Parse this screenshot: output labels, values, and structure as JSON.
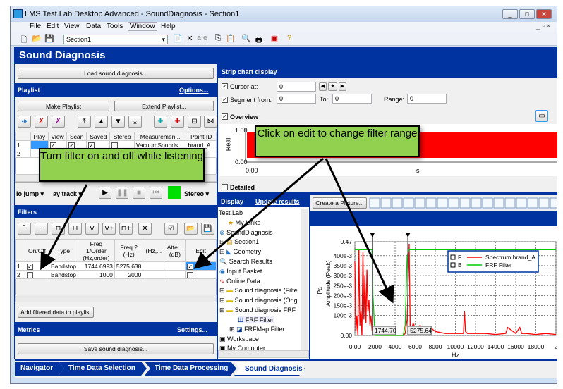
{
  "window": {
    "title": "LMS Test.Lab Desktop Advanced - SoundDiagnosis - Section1",
    "controls": [
      "_",
      "□",
      "✕"
    ]
  },
  "menu": [
    "File",
    "Edit",
    "View",
    "Data",
    "Tools",
    "Window",
    "Help"
  ],
  "toolbar": {
    "section": "Section1"
  },
  "page_title": "Sound Diagnosis",
  "left": {
    "load_button": "Load sound diagnosis...",
    "playlist": {
      "title": "Playlist",
      "options": "Options...",
      "make": "Make Playlist",
      "extend": "Extend Playlist...",
      "columns": [
        "",
        "Play",
        "View",
        "Scan",
        "Saved",
        "Stereo",
        "Measuremen...",
        "Point ID"
      ],
      "rows": [
        {
          "n": "1",
          "view": true,
          "scan": true,
          "saved": true,
          "stereo": false,
          "measurement": "VacuumSounds",
          "point": "brand_A"
        },
        {
          "n": "2"
        }
      ]
    },
    "playback": {
      "jump": "lo jump",
      "track": "ay track",
      "mode": "Stereo"
    },
    "filters": {
      "title": "Filters",
      "columns": [
        "",
        "On/Off",
        "Type",
        "Freq 1/Order (Hz,order)",
        "Freq 2 (Hz)",
        "(Hz,...",
        "Atte... (dB)",
        "Edit"
      ],
      "rows": [
        {
          "n": "1",
          "on": true,
          "type": "Bandstop",
          "f1": "1744.6993",
          "f2": "5275.638",
          "edit": true
        },
        {
          "n": "2",
          "on": false,
          "type": "Bandstop",
          "f1": "1000",
          "f2": "2000",
          "edit": false
        }
      ],
      "add_button": "Add filtered data to playlist"
    },
    "metrics": {
      "title": "Metrics",
      "settings": "Settings...",
      "save_button": "Save sound diagnosis..."
    }
  },
  "strip": {
    "title": "Strip chart display",
    "cursor_label": "Cursor at:",
    "cursor": "0",
    "segment_label": "Segment from:",
    "segment_from": "0",
    "to_label": "To:",
    "to": "0",
    "range_label": "Range:",
    "range": "0",
    "overview": "Overview",
    "detailed": "Detailed",
    "y_label": "Real",
    "y_ticks": [
      "1.00",
      "0.00"
    ],
    "x_ticks": [
      "0.00"
    ],
    "x_unit": "s"
  },
  "display": {
    "title": "Display",
    "update": "Update results",
    "tree": [
      "Test.Lab",
      "My Links",
      "SoundDiagnosis",
      "Section1",
      "Geometry",
      "Search Results",
      "Input Basket",
      "Online Data",
      "Sound diagnosis (Filte",
      "Sound diagnosis (Orig",
      "Sound diagnosis FRF",
      "FRF Filter",
      "FRFMap Filter",
      "Workspace",
      "My Computer"
    ]
  },
  "picture_button": "Create a Picture...",
  "chart_data": {
    "type": "line",
    "xlabel": "Hz",
    "ylabel": "Amplitude (Peak)",
    "yunit": "Pa",
    "xlim": [
      0,
      20000
    ],
    "ylim": [
      0,
      0.47
    ],
    "x_ticks": [
      "0.00",
      "2000",
      "4000",
      "6000",
      "8000",
      "10000",
      "12000",
      "14000",
      "16000",
      "18000",
      "2"
    ],
    "y_ticks": [
      "0.47",
      "400e-3",
      "350e-3",
      "300e-3",
      "250e-3",
      "200e-3",
      "150e-3",
      "100e-3",
      "0.00"
    ],
    "cursors": [
      "1744.70",
      "5275.64"
    ],
    "legend": [
      "F",
      "B"
    ],
    "series": [
      {
        "name": "Spectrum brand_A",
        "color": "#ff0000",
        "x": [
          0,
          100,
          200,
          300,
          400,
          500,
          600,
          700,
          800,
          900,
          1000,
          1100,
          1200,
          1300,
          1400,
          1500,
          1600,
          1700,
          1800,
          2000,
          2500,
          3000,
          4000,
          4800,
          5000,
          5200,
          5400,
          5500,
          5600,
          5800,
          6000,
          6500,
          7000,
          7500,
          8000,
          9000,
          10000,
          10800,
          10900,
          11000,
          11200,
          12000,
          13000,
          14000,
          15000,
          15200,
          16000,
          16400,
          16600,
          17000,
          18000,
          19000,
          20000
        ],
        "y": [
          0.37,
          0.02,
          0.1,
          0.0,
          0.43,
          0.05,
          0.12,
          0.0,
          0.42,
          0.08,
          0.3,
          0.06,
          0.33,
          0.12,
          0.18,
          0.05,
          0.1,
          0.03,
          0.04,
          0.02,
          0.0,
          0.0,
          0.0,
          0.0,
          0.01,
          0.08,
          0.46,
          0.05,
          0.03,
          0.06,
          0.04,
          0.05,
          0.03,
          0.04,
          0.02,
          0.01,
          0.01,
          0.01,
          0.12,
          0.02,
          0.01,
          0.01,
          0.01,
          0.005,
          0.01,
          0.04,
          0.01,
          0.04,
          0.01,
          0.01,
          0.005,
          0.01,
          0.005
        ]
      },
      {
        "name": "FRF Filter",
        "color": "#00cc00",
        "x": [
          0,
          1700,
          1800,
          2000,
          4800,
          5000,
          5200,
          5400,
          6000,
          20000
        ],
        "y": [
          0.43,
          0.43,
          0.2,
          0.0,
          0.0,
          0.05,
          0.4,
          0.43,
          0.43,
          0.43
        ]
      }
    ]
  },
  "callouts": {
    "filter_toggle": "Turn filter on and off while listening",
    "edit_range": "Click on edit to change filter range"
  },
  "nav": [
    "Navigator",
    "Time Data Selection",
    "Time Data Processing",
    "Sound Diagnosis"
  ]
}
